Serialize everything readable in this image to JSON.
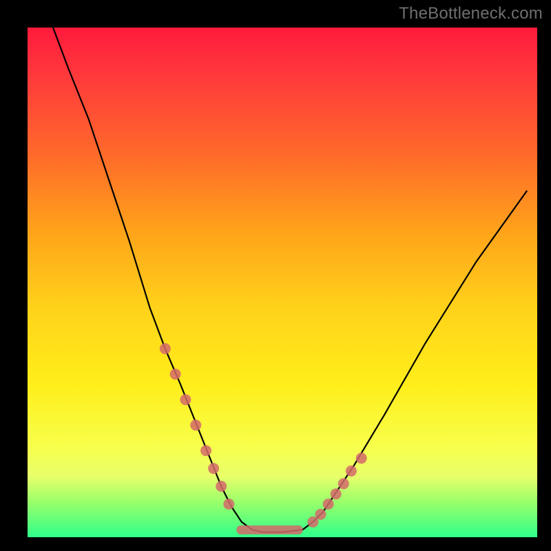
{
  "watermark": "TheBottleneck.com",
  "colors": {
    "frame": "#000000",
    "marker": "#d46a6a",
    "curve": "#000000",
    "gradient_stops": [
      {
        "pos": 0.0,
        "color": "#ff1a3c"
      },
      {
        "pos": 0.1,
        "color": "#ff3b3b"
      },
      {
        "pos": 0.25,
        "color": "#ff6a2a"
      },
      {
        "pos": 0.4,
        "color": "#ffa31a"
      },
      {
        "pos": 0.55,
        "color": "#ffd21a"
      },
      {
        "pos": 0.7,
        "color": "#ffee1a"
      },
      {
        "pos": 0.82,
        "color": "#f7ff4a"
      },
      {
        "pos": 0.88,
        "color": "#e8ff6a"
      },
      {
        "pos": 0.93,
        "color": "#9bff6a"
      },
      {
        "pos": 1.0,
        "color": "#2fff8a"
      }
    ]
  },
  "chart_data": {
    "type": "line",
    "title": "",
    "xlabel": "",
    "ylabel": "",
    "xlim": [
      0,
      1
    ],
    "ylim": [
      0,
      1
    ],
    "note": "Axes unlabeled; coordinates are normalized to the colored plot area (0,0)=top-left, (1,1)=bottom-right.",
    "series": [
      {
        "name": "V-curve",
        "x": [
          0.05,
          0.08,
          0.12,
          0.16,
          0.2,
          0.24,
          0.27,
          0.3,
          0.32,
          0.34,
          0.36,
          0.38,
          0.4,
          0.42,
          0.44,
          0.46,
          0.5,
          0.54,
          0.56,
          0.58,
          0.6,
          0.64,
          0.7,
          0.78,
          0.88,
          0.98
        ],
        "y": [
          0.0,
          0.08,
          0.18,
          0.3,
          0.42,
          0.55,
          0.63,
          0.7,
          0.75,
          0.8,
          0.85,
          0.9,
          0.94,
          0.97,
          0.985,
          0.99,
          0.99,
          0.985,
          0.97,
          0.95,
          0.92,
          0.86,
          0.76,
          0.62,
          0.46,
          0.32
        ]
      }
    ],
    "markers": {
      "name": "highlighted points",
      "color": "#d46a6a",
      "note": "salmon dots along curve near the trough plus a short flat bar at the minimum",
      "x": [
        0.27,
        0.29,
        0.31,
        0.33,
        0.35,
        0.365,
        0.38,
        0.395,
        0.56,
        0.575,
        0.59,
        0.605,
        0.62,
        0.635,
        0.655
      ],
      "y": [
        0.63,
        0.68,
        0.73,
        0.78,
        0.83,
        0.865,
        0.9,
        0.935,
        0.97,
        0.955,
        0.935,
        0.915,
        0.895,
        0.87,
        0.845
      ]
    },
    "flat_bar": {
      "x_start": 0.41,
      "x_end": 0.54,
      "y": 0.985
    }
  }
}
